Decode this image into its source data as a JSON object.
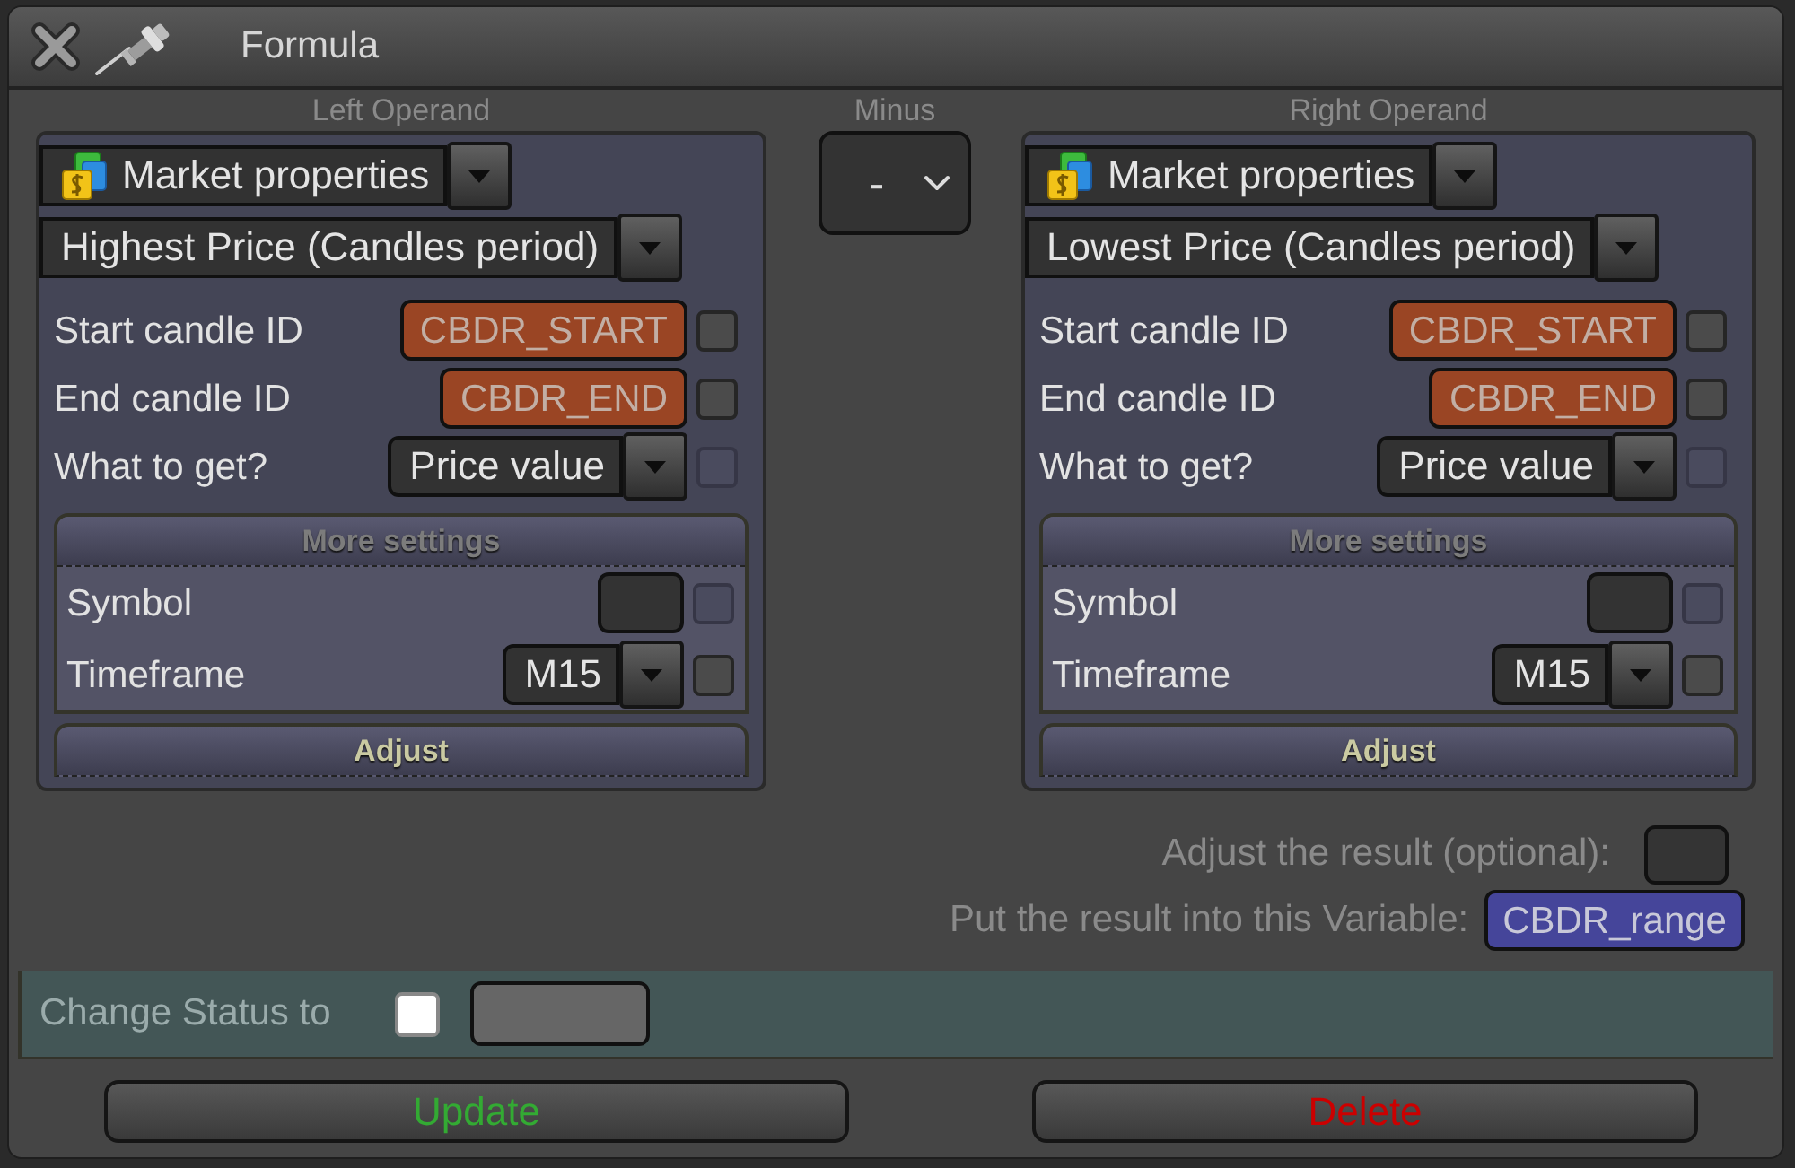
{
  "window": {
    "title": "Formula"
  },
  "operands": [
    {
      "heading": "Left Operand",
      "source": "Market properties",
      "property": "Highest Price (Candles period)",
      "params": [
        {
          "kind": "variable",
          "label": "Start candle ID",
          "value": "CBDR_START",
          "checkbox": {
            "checked": false,
            "disabled": false
          }
        },
        {
          "kind": "variable",
          "label": "End candle ID",
          "value": "CBDR_END",
          "checkbox": {
            "checked": false,
            "disabled": false
          }
        },
        {
          "kind": "select",
          "label": "What to get?",
          "value": "Price value",
          "checkbox": {
            "checked": false,
            "disabled": true
          }
        }
      ],
      "sections": [
        {
          "title": "More settings",
          "expanded": true,
          "params": [
            {
              "kind": "text",
              "label": "Symbol",
              "checkbox": {
                "checked": false,
                "disabled": true
              }
            },
            {
              "kind": "select",
              "label": "Timeframe",
              "value": "M15",
              "checkbox": {
                "checked": false,
                "disabled": false
              }
            }
          ]
        },
        {
          "title": "Adjust",
          "expanded": false
        }
      ]
    },
    {
      "heading": "Right Operand",
      "source": "Market properties",
      "property": "Lowest Price (Candles period)",
      "params": [
        {
          "kind": "variable",
          "label": "Start candle ID",
          "value": "CBDR_START",
          "checkbox": {
            "checked": false,
            "disabled": false
          }
        },
        {
          "kind": "variable",
          "label": "End candle ID",
          "value": "CBDR_END",
          "checkbox": {
            "checked": false,
            "disabled": false
          }
        },
        {
          "kind": "select",
          "label": "What to get?",
          "value": "Price value",
          "checkbox": {
            "checked": false,
            "disabled": true
          }
        }
      ],
      "sections": [
        {
          "title": "More settings",
          "expanded": true,
          "params": [
            {
              "kind": "text",
              "label": "Symbol",
              "checkbox": {
                "checked": false,
                "disabled": true
              }
            },
            {
              "kind": "select",
              "label": "Timeframe",
              "value": "M15",
              "checkbox": {
                "checked": false,
                "disabled": false
              }
            }
          ]
        },
        {
          "title": "Adjust",
          "expanded": false
        }
      ]
    }
  ],
  "operator": {
    "label": "Minus",
    "value": "-"
  },
  "result": {
    "adjust_label": "Adjust the result (optional):",
    "variable_label": "Put the result into this Variable:",
    "variable": "CBDR_range"
  },
  "status": {
    "label": "Change Status to",
    "checked": false
  },
  "buttons": [
    {
      "kind": "update",
      "label": "Update"
    },
    {
      "kind": "delete",
      "label": "Delete"
    }
  ]
}
